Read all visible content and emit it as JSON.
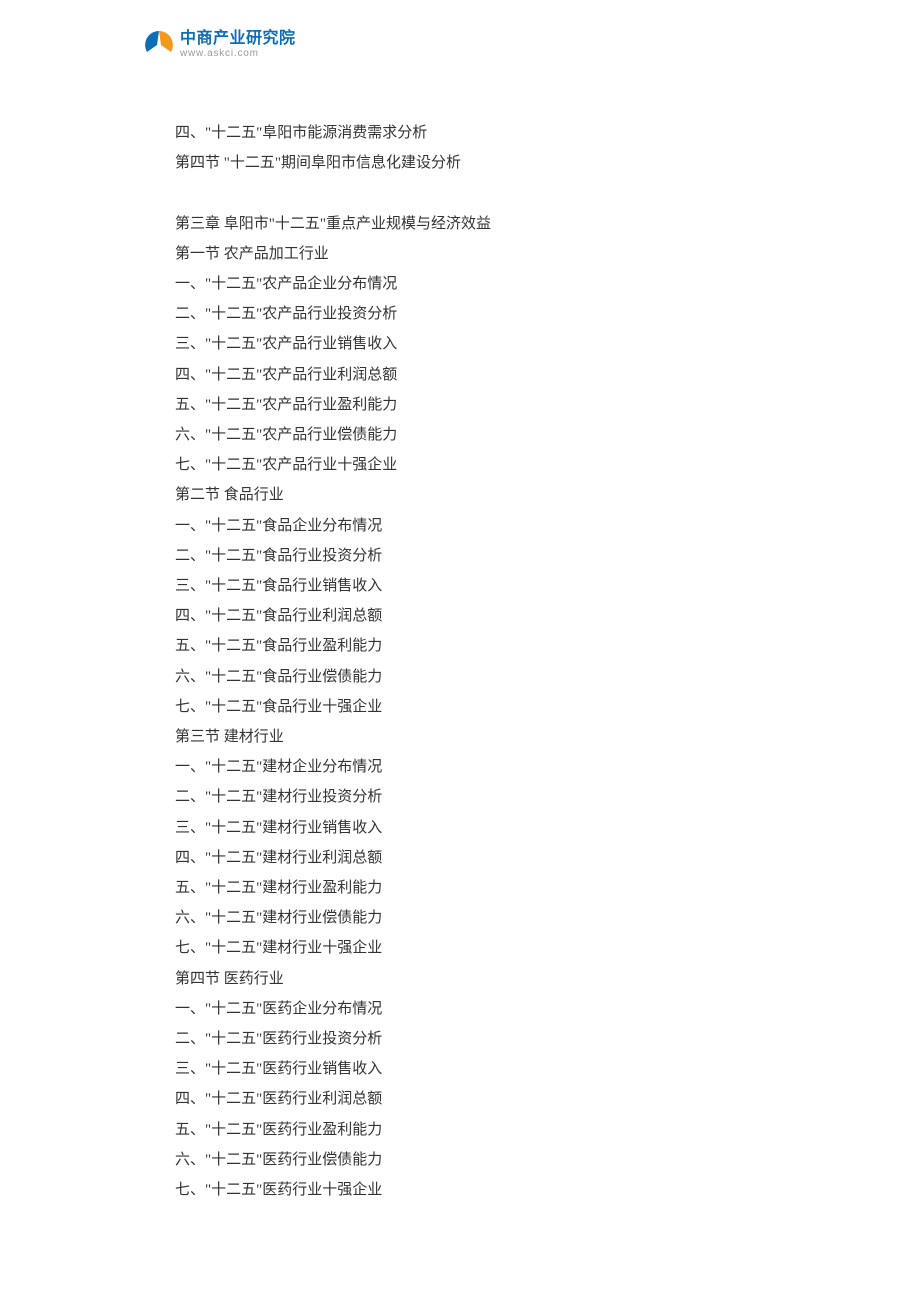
{
  "logo": {
    "cn": "中商产业研究院",
    "en": "www.askci.com"
  },
  "lines": [
    "四、\"十二五\"阜阳市能源消费需求分析",
    "第四节  \"十二五\"期间阜阳市信息化建设分析",
    "",
    "第三章  阜阳市\"十二五\"重点产业规模与经济效益",
    "第一节  农产品加工行业",
    "一、\"十二五\"农产品企业分布情况",
    "二、\"十二五\"农产品行业投资分析",
    "三、\"十二五\"农产品行业销售收入",
    "四、\"十二五\"农产品行业利润总额",
    "五、\"十二五\"农产品行业盈利能力",
    "六、\"十二五\"农产品行业偿债能力",
    "七、\"十二五\"农产品行业十强企业",
    "第二节  食品行业",
    "一、\"十二五\"食品企业分布情况",
    "二、\"十二五\"食品行业投资分析",
    "三、\"十二五\"食品行业销售收入",
    "四、\"十二五\"食品行业利润总额",
    "五、\"十二五\"食品行业盈利能力",
    "六、\"十二五\"食品行业偿债能力",
    "七、\"十二五\"食品行业十强企业",
    "第三节  建材行业",
    "一、\"十二五\"建材企业分布情况",
    "二、\"十二五\"建材行业投资分析",
    "三、\"十二五\"建材行业销售收入",
    "四、\"十二五\"建材行业利润总额",
    "五、\"十二五\"建材行业盈利能力",
    "六、\"十二五\"建材行业偿债能力",
    "七、\"十二五\"建材行业十强企业",
    "第四节  医药行业",
    "一、\"十二五\"医药企业分布情况",
    "二、\"十二五\"医药行业投资分析",
    "三、\"十二五\"医药行业销售收入",
    "四、\"十二五\"医药行业利润总额",
    "五、\"十二五\"医药行业盈利能力",
    "六、\"十二五\"医药行业偿债能力",
    "七、\"十二五\"医药行业十强企业"
  ]
}
